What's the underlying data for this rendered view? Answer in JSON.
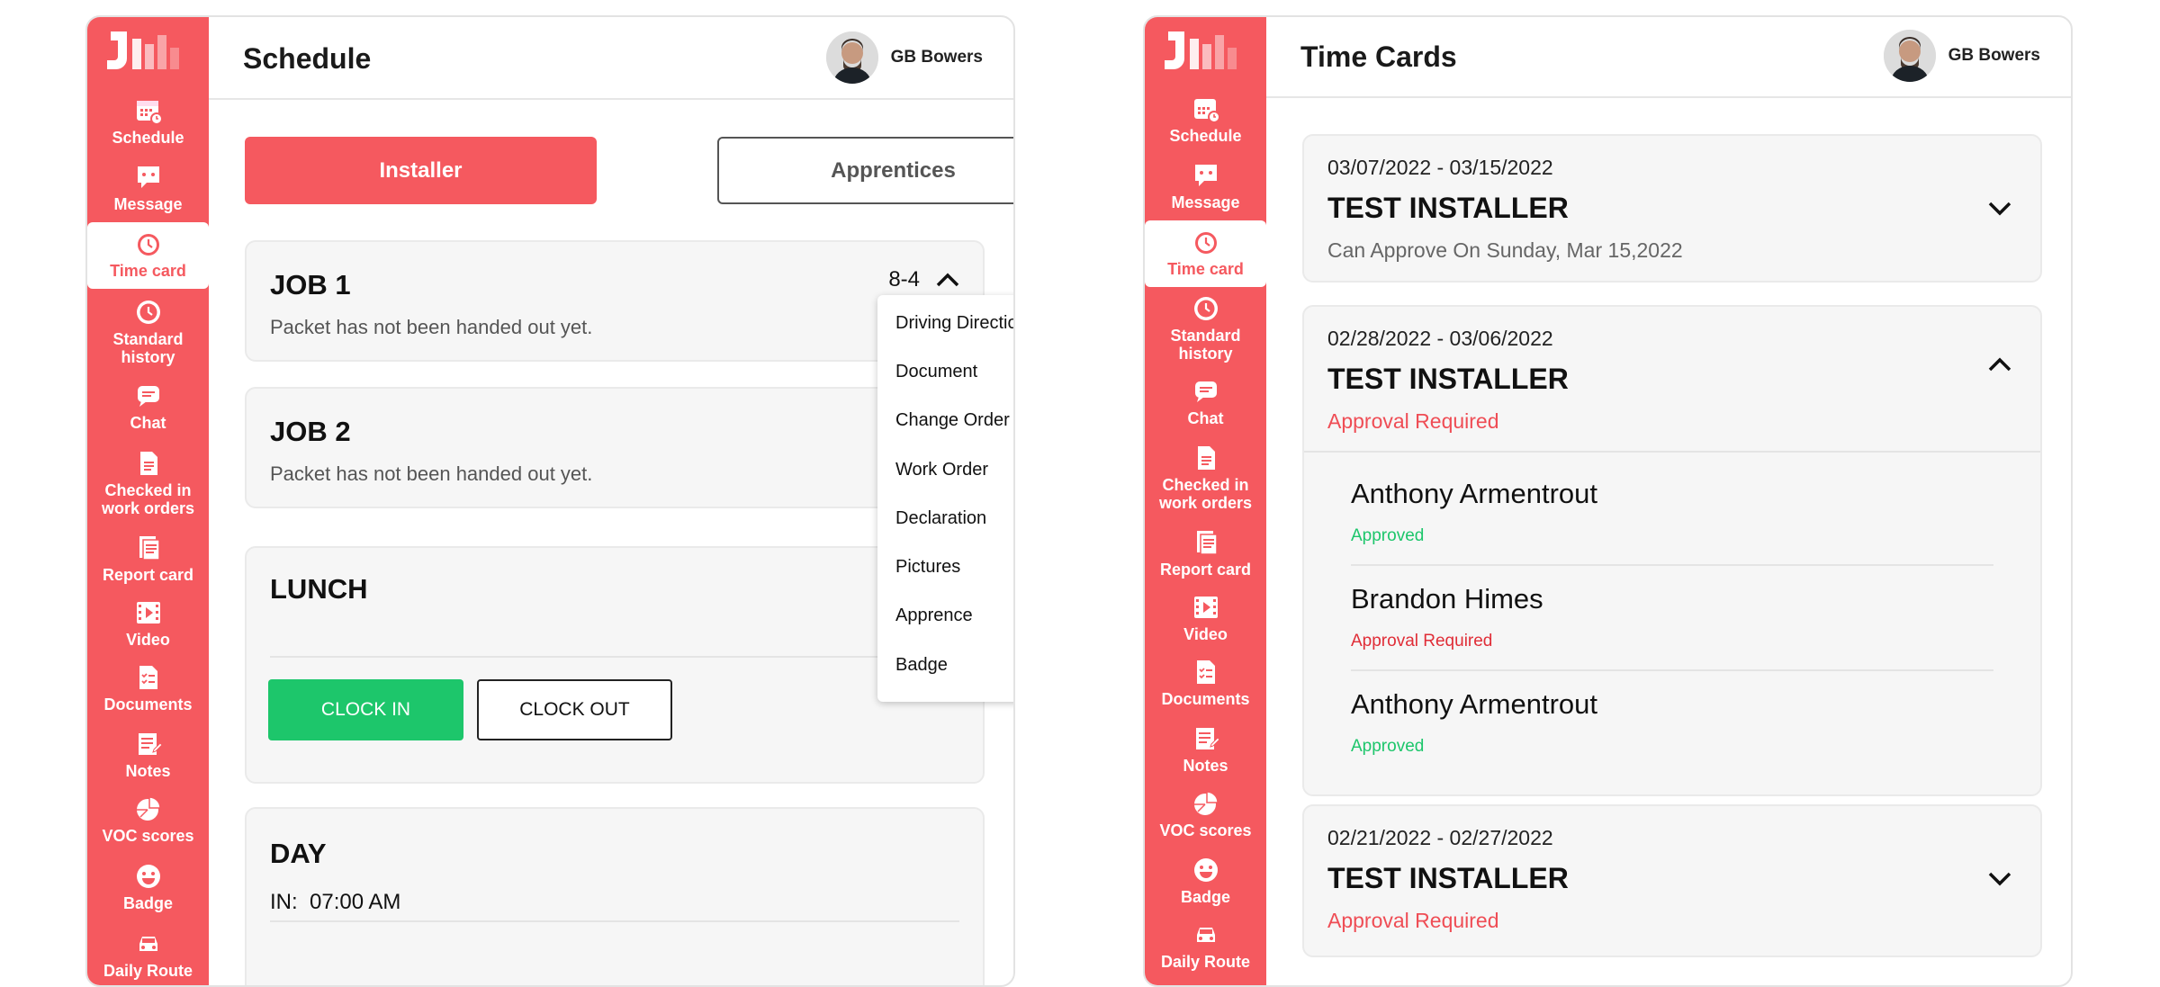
{
  "colors": {
    "brand": "#f5595f",
    "green": "#1dc66b",
    "red_status": "#e02d37"
  },
  "sidebar": {
    "items": [
      {
        "label": "Schedule",
        "icon": "calendar-icon"
      },
      {
        "label": "Message",
        "icon": "message-icon"
      },
      {
        "label": "Time card",
        "icon": "clock-icon"
      },
      {
        "label": "Standard history",
        "icon": "history-icon"
      },
      {
        "label": "Chat",
        "icon": "chat-icon"
      },
      {
        "label": "Checked in work orders",
        "icon": "document-icon"
      },
      {
        "label": "Report card",
        "icon": "report-icon"
      },
      {
        "label": "Video",
        "icon": "video-icon"
      },
      {
        "label": "Documents",
        "icon": "checklist-icon"
      },
      {
        "label": "Notes",
        "icon": "notes-icon"
      },
      {
        "label": "VOC scores",
        "icon": "pie-chart-icon"
      },
      {
        "label": "Badge",
        "icon": "smiley-icon"
      },
      {
        "label": "Daily Route",
        "icon": "car-icon"
      }
    ],
    "active_left": "Time card",
    "active_right": "Time card"
  },
  "user": {
    "name": "GB Bowers"
  },
  "schedule": {
    "title": "Schedule",
    "tabs": {
      "installer": "Installer",
      "apprentices": "Apprentices"
    },
    "job1": {
      "title": "JOB 1",
      "subtitle": "Packet has not been handed out yet.",
      "time": "8-4"
    },
    "job2": {
      "title": "JOB 2",
      "subtitle": "Packet has not been handed out yet."
    },
    "lunch": {
      "title": "LUNCH",
      "clock_in": "CLOCK IN",
      "clock_out": "CLOCK OUT"
    },
    "day": {
      "title": "DAY",
      "in_label": "IN:",
      "in_time": "07:00 AM"
    },
    "menu": [
      "Driving Direction",
      "Document",
      "Change Order",
      "Work Order",
      "Declaration",
      "Pictures",
      "Apprence",
      "Badge"
    ]
  },
  "timecards": {
    "title": "Time Cards",
    "cards": [
      {
        "dates": "03/07/2022 - 03/15/2022",
        "title": "TEST INSTALLER",
        "status": "Can Approve On Sunday, Mar 15,2022"
      },
      {
        "dates": "02/28/2022 - 03/06/2022",
        "title": "TEST INSTALLER",
        "status": "Approval Required",
        "entries": [
          {
            "name": "Anthony Armentrout",
            "status": "Approved"
          },
          {
            "name": "Brandon Himes",
            "status": "Approval Required"
          },
          {
            "name": "Anthony Armentrout",
            "status": "Approved"
          }
        ]
      },
      {
        "dates": "02/21/2022 - 02/27/2022",
        "title": "TEST INSTALLER",
        "status": "Approval Required"
      }
    ]
  }
}
